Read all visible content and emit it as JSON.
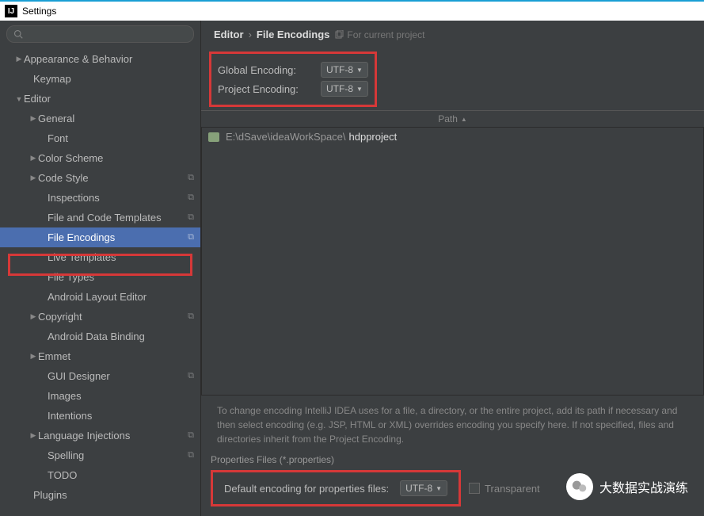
{
  "window": {
    "title": "Settings"
  },
  "sidebar": {
    "items": [
      {
        "label": "Appearance & Behavior",
        "indent": 18,
        "arrow": "▶"
      },
      {
        "label": "Keymap",
        "indent": 30,
        "arrow": ""
      },
      {
        "label": "Editor",
        "indent": 18,
        "arrow": "▼"
      },
      {
        "label": "General",
        "indent": 36,
        "arrow": "▶"
      },
      {
        "label": "Font",
        "indent": 48,
        "arrow": ""
      },
      {
        "label": "Color Scheme",
        "indent": 36,
        "arrow": "▶"
      },
      {
        "label": "Code Style",
        "indent": 36,
        "arrow": "▶",
        "copy": true
      },
      {
        "label": "Inspections",
        "indent": 48,
        "arrow": "",
        "copy": true
      },
      {
        "label": "File and Code Templates",
        "indent": 48,
        "arrow": "",
        "copy": true
      },
      {
        "label": "File Encodings",
        "indent": 48,
        "arrow": "",
        "copy": true,
        "selected": true
      },
      {
        "label": "Live Templates",
        "indent": 48,
        "arrow": ""
      },
      {
        "label": "File Types",
        "indent": 48,
        "arrow": ""
      },
      {
        "label": "Android Layout Editor",
        "indent": 48,
        "arrow": ""
      },
      {
        "label": "Copyright",
        "indent": 36,
        "arrow": "▶",
        "copy": true
      },
      {
        "label": "Android Data Binding",
        "indent": 48,
        "arrow": ""
      },
      {
        "label": "Emmet",
        "indent": 36,
        "arrow": "▶"
      },
      {
        "label": "GUI Designer",
        "indent": 48,
        "arrow": "",
        "copy": true
      },
      {
        "label": "Images",
        "indent": 48,
        "arrow": ""
      },
      {
        "label": "Intentions",
        "indent": 48,
        "arrow": ""
      },
      {
        "label": "Language Injections",
        "indent": 36,
        "arrow": "▶",
        "copy": true
      },
      {
        "label": "Spelling",
        "indent": 48,
        "arrow": "",
        "copy": true
      },
      {
        "label": "TODO",
        "indent": 48,
        "arrow": ""
      },
      {
        "label": "Plugins",
        "indent": 30,
        "arrow": ""
      }
    ]
  },
  "breadcrumb": {
    "root": "Editor",
    "leaf": "File Encodings",
    "hint": "For current project"
  },
  "encodings": {
    "global_label": "Global Encoding:",
    "global_value": "UTF-8",
    "project_label": "Project Encoding:",
    "project_value": "UTF-8"
  },
  "table": {
    "header": "Path",
    "row_prefix": "E:\\dSave\\ideaWorkSpace\\",
    "row_project": "hdpproject"
  },
  "help": "To change encoding IntelliJ IDEA uses for a file, a directory, or the entire project, add its path if necessary and then select encoding (e.g. JSP, HTML or XML) overrides encoding you specify here. If not specified, files and directories inherit from the Project Encoding.",
  "props": {
    "section": "Properties Files (*.properties)",
    "label": "Default encoding for properties files:",
    "value": "UTF-8",
    "checkbox": "Transparent"
  },
  "watermark": "大数据实战演练"
}
